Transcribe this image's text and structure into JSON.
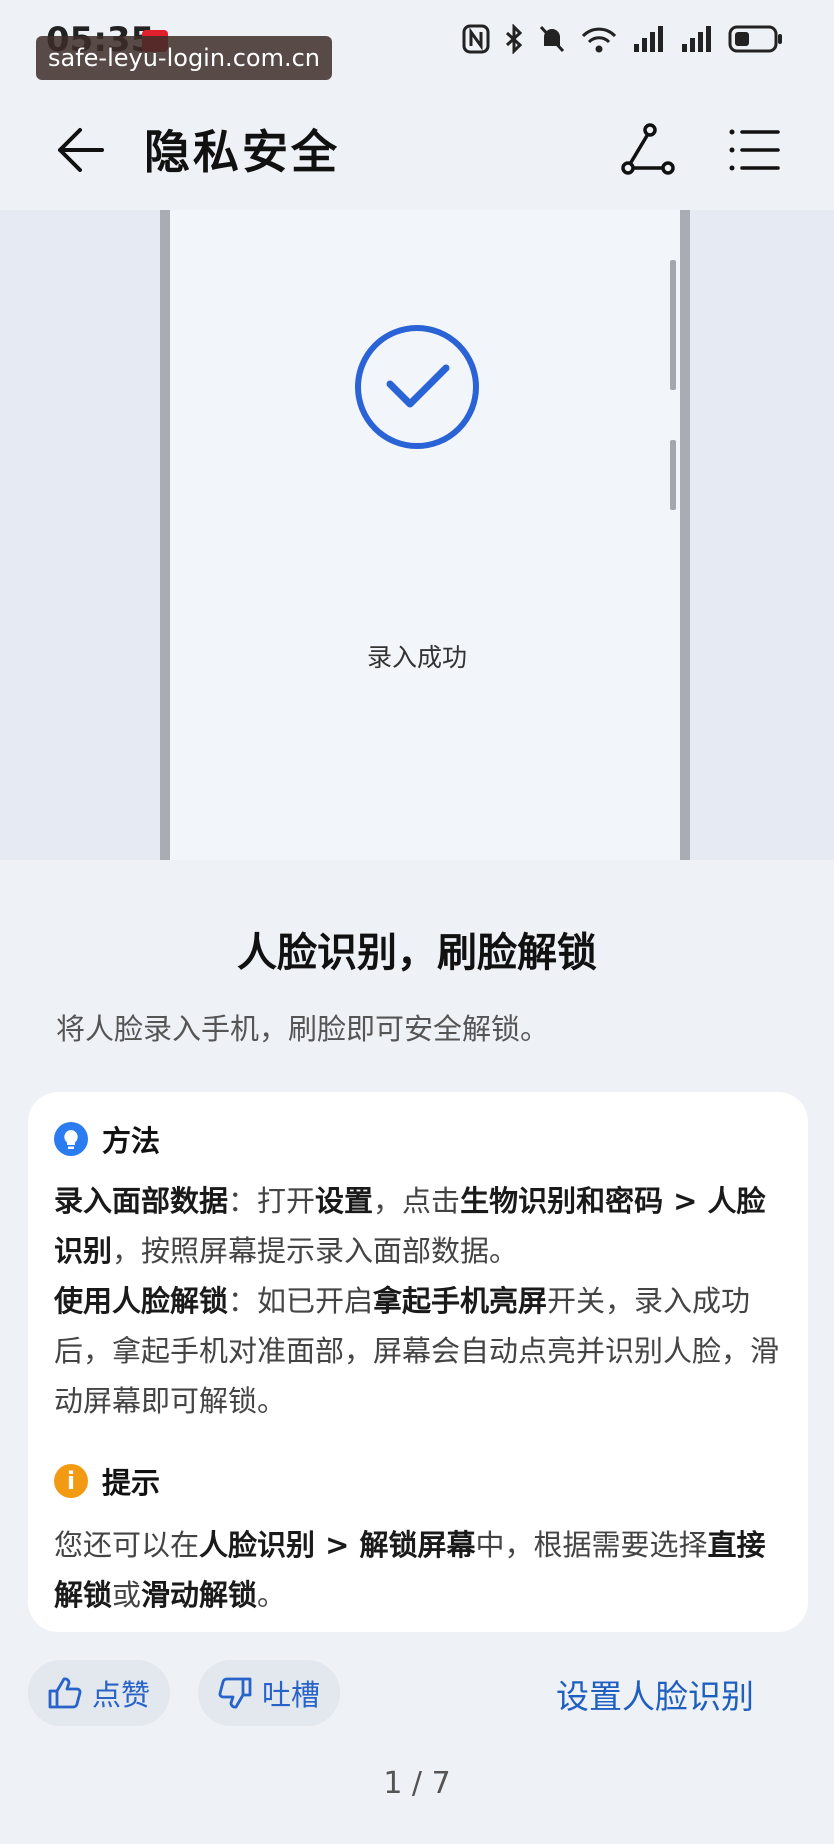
{
  "status_bar": {
    "time": "05:35",
    "watermark": "safe-leyu-login.com.cn"
  },
  "header": {
    "title": "隐私安全"
  },
  "illustration": {
    "status_text": "录入成功"
  },
  "feature": {
    "title": "人脸识别，刷脸解锁",
    "subtitle": "将人脸录入手机，刷脸即可安全解锁。"
  },
  "card": {
    "method_heading": "方法",
    "method": {
      "p1_label": "录入面部数据",
      "p1_text_a": "：打开",
      "p1_setting": "设置",
      "p1_text_b": "，点击",
      "p1_path": "生物识别和密码 > 人脸识别",
      "p1_text_c": "，按照屏幕提示录入面部数据。",
      "p2_label": "使用人脸解锁",
      "p2_text_a": "：如已开启",
      "p2_switch": "拿起手机亮屏",
      "p2_text_b": "开关，录入成功后，拿起手机对准面部，屏幕会自动点亮并识别人脸，滑动屏幕即可解锁。"
    },
    "tip_heading": "提示",
    "tip": {
      "text_a": "您还可以在",
      "path": "人脸识别 > 解锁屏幕",
      "text_b": "中，根据需要选择",
      "opt1": "直接解锁",
      "text_c": "或",
      "opt2": "滑动解锁",
      "text_d": "。"
    }
  },
  "actions": {
    "like_label": "点赞",
    "dislike_label": "吐槽",
    "setup_label": "设置人脸识别"
  },
  "pager": {
    "indicator": "1 / 7"
  },
  "colors": {
    "accent_blue": "#1f5fbf",
    "success_blue": "#2a63d6",
    "method_icon": "#2a7cf0",
    "tip_icon": "#f29a12"
  }
}
